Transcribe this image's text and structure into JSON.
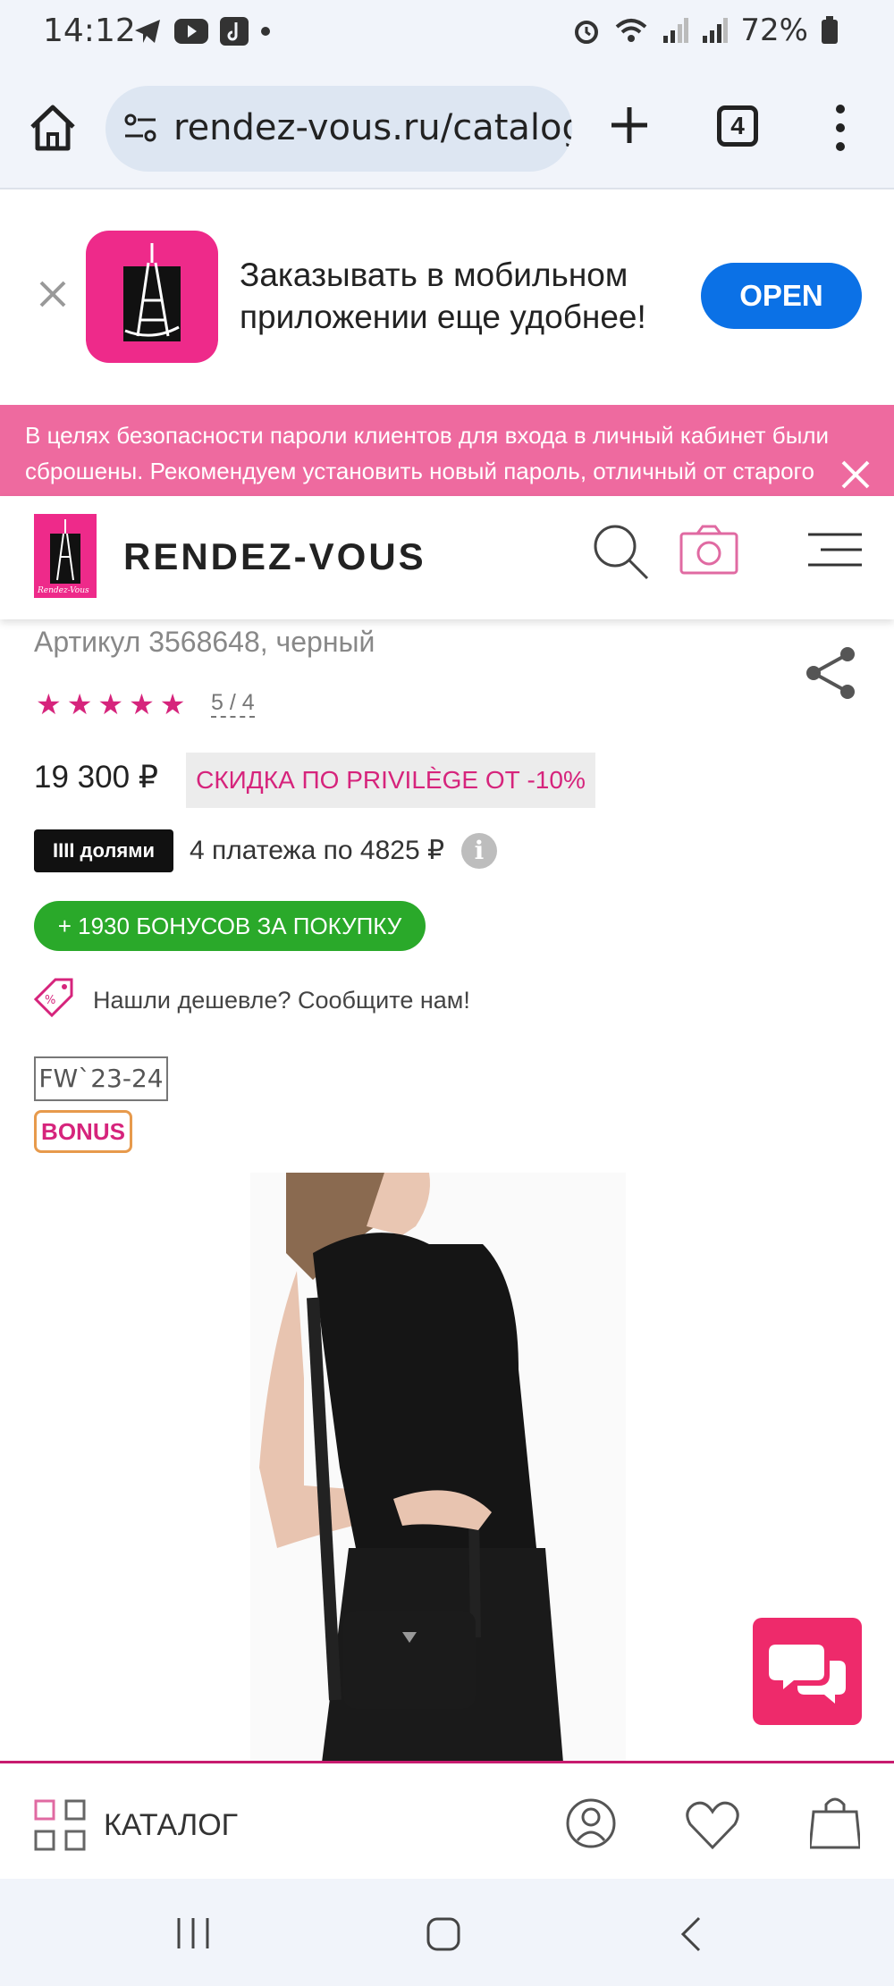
{
  "status_bar": {
    "time": "14:12",
    "app_icons": [
      "telegram-icon",
      "youtube-icon",
      "tiktok-icon",
      "dot-icon"
    ],
    "system_icons": [
      "alarm-icon",
      "wifi-icon",
      "signal-icon",
      "signal-icon",
      "battery-icon"
    ],
    "battery": "72%"
  },
  "browser": {
    "url": "rendez-vous.ru/catalog",
    "tabs_count": "4"
  },
  "app_promo": {
    "text": "Заказывать в мобильном приложении еще удобнее!",
    "open_label": "OPEN"
  },
  "notice": {
    "text": "В целях безопасности пароли клиентов для входа в личный кабинет были сброшены. Рекомендуем установить новый пароль, отличный от старого"
  },
  "site_header": {
    "logo_text": "RENDEZ-VOUS",
    "logo_mark": "Rendez-Vous"
  },
  "product": {
    "article": "Артикул 3568648, черный",
    "stars": [
      "★",
      "★",
      "★",
      "★",
      "★"
    ],
    "rating": "5 / 4",
    "price": "19 300 ₽",
    "privilege": "СКИДКА ПО PRIVILÈGE ОТ -10%",
    "dolyami_label": "IIII долями",
    "installments": "4 платежа по 4825 ₽",
    "info_label": "i",
    "bonus_button": "+ 1930 БОНУСОВ ЗА ПОКУПКУ",
    "cheaper_text": "Нашли дешевле? Сообщите нам!",
    "season_tag": "FW`23-24",
    "bonus_badge": "BONUS"
  },
  "bottom_nav": {
    "catalog_label": "КАТАЛОГ"
  },
  "colors": {
    "brand_pink": "#ee2a8a",
    "notice_pink": "#ee6a9f",
    "accent_magenta": "#d6247c",
    "open_blue": "#0b71e6",
    "bonus_green": "#2aa92a"
  }
}
